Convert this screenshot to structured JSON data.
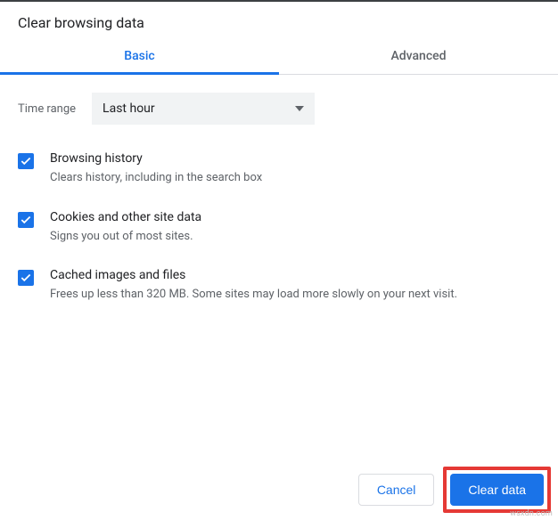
{
  "title": "Clear browsing data",
  "tabs": {
    "basic": "Basic",
    "advanced": "Advanced"
  },
  "timeRange": {
    "label": "Time range",
    "value": "Last hour"
  },
  "options": [
    {
      "title": "Browsing history",
      "desc": "Clears history, including in the search box"
    },
    {
      "title": "Cookies and other site data",
      "desc": "Signs you out of most sites."
    },
    {
      "title": "Cached images and files",
      "desc": "Frees up less than 320 MB. Some sites may load more slowly on your next visit."
    }
  ],
  "buttons": {
    "cancel": "Cancel",
    "clear": "Clear data"
  },
  "watermark": "wsxdn.com"
}
